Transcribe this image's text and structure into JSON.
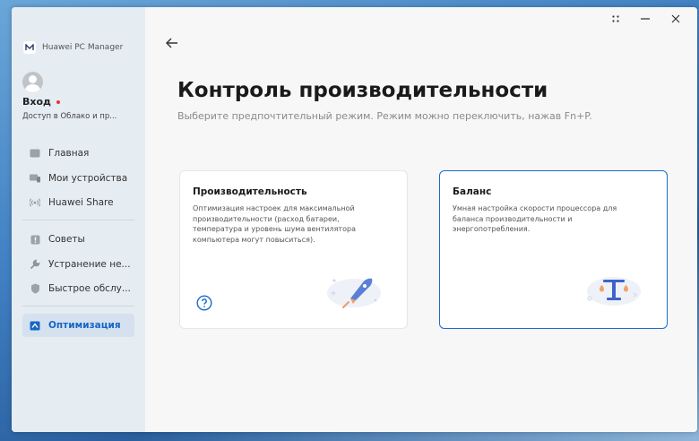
{
  "app": {
    "title": "Huawei PC Manager"
  },
  "account": {
    "login": "Вход",
    "subtitle": "Доступ в Облако и пр..."
  },
  "nav": {
    "home": "Главная",
    "devices": "Мои устройства",
    "share": "Huawei Share",
    "tips": "Советы",
    "troubleshoot": "Устранение не...",
    "service": "Быстрое обслу...",
    "optimization": "Оптимизация"
  },
  "page": {
    "title": "Контроль производительности",
    "subtitle": "Выберите предпочтительный режим. Режим можно переключить, нажав Fn+P."
  },
  "cards": {
    "performance": {
      "title": "Производительность",
      "desc": "Оптимизация настроек для максимальной производительности (расход батареи, температура и уровень шума вентилятора компьютера могут повыситься)."
    },
    "balance": {
      "title": "Баланс",
      "desc": "Умная настройка скорости процессора для баланса производительности и энергопотребления."
    }
  },
  "colors": {
    "accent": "#1a6bd1",
    "sidebar": "#e5ecf2",
    "badge": "#e53935"
  },
  "selected_mode": "balance"
}
